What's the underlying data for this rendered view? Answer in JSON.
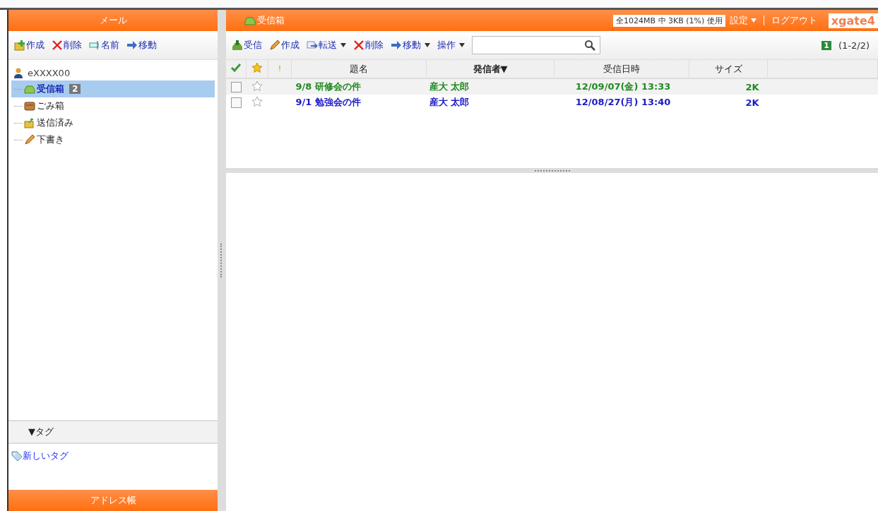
{
  "left_panel": {
    "title": "メール",
    "toolbar": [
      {
        "kind": "new-folder",
        "label": "作成"
      },
      {
        "kind": "delete",
        "label": "削除"
      },
      {
        "kind": "rename",
        "label": "名前"
      },
      {
        "kind": "move",
        "label": "移動"
      }
    ],
    "account": "eXXXX00",
    "folders": [
      {
        "kind": "inbox",
        "label": "受信箱",
        "badge": "2",
        "selected": true
      },
      {
        "kind": "trash",
        "label": "ごみ箱",
        "selected": false
      },
      {
        "kind": "sent",
        "label": "送信済み",
        "selected": false
      },
      {
        "kind": "draft",
        "label": "下書き",
        "selected": false
      }
    ],
    "tags_header": "▼タグ",
    "new_tag": "新しいタグ",
    "address_book": "アドレス帳"
  },
  "right_panel": {
    "title": "受信箱",
    "quota": "全1024MB 中 3KB (1%) 使用",
    "settings": "設定",
    "logout": "ログアウト",
    "logo": "xgate4",
    "toolbar": [
      {
        "kind": "receive",
        "label": "受信",
        "dropdown": false
      },
      {
        "kind": "compose",
        "label": "作成",
        "dropdown": false
      },
      {
        "kind": "forward",
        "label": "転送",
        "dropdown": true
      },
      {
        "kind": "delete",
        "label": "削除",
        "dropdown": false
      },
      {
        "kind": "move",
        "label": "移動",
        "dropdown": true
      },
      {
        "kind": "action",
        "label": "操作",
        "dropdown": true
      }
    ],
    "page": "1",
    "count": "(1-2/2)",
    "columns": [
      "!",
      "題名",
      "発信者▼",
      "受信日時",
      "サイズ"
    ],
    "rows": [
      {
        "subject": "9/8 研修会の件",
        "sender": "産大 太郎",
        "date": "12/09/07(金) 13:33",
        "size": "2K",
        "color": "#1f8a1f",
        "checked": false,
        "starred": false,
        "selected": true
      },
      {
        "subject": "9/1 勉強会の件",
        "sender": "産大 太郎",
        "date": "12/08/27(月) 13:40",
        "size": "2K",
        "color": "#1a1ac8",
        "checked": false,
        "starred": false,
        "selected": false
      }
    ]
  }
}
